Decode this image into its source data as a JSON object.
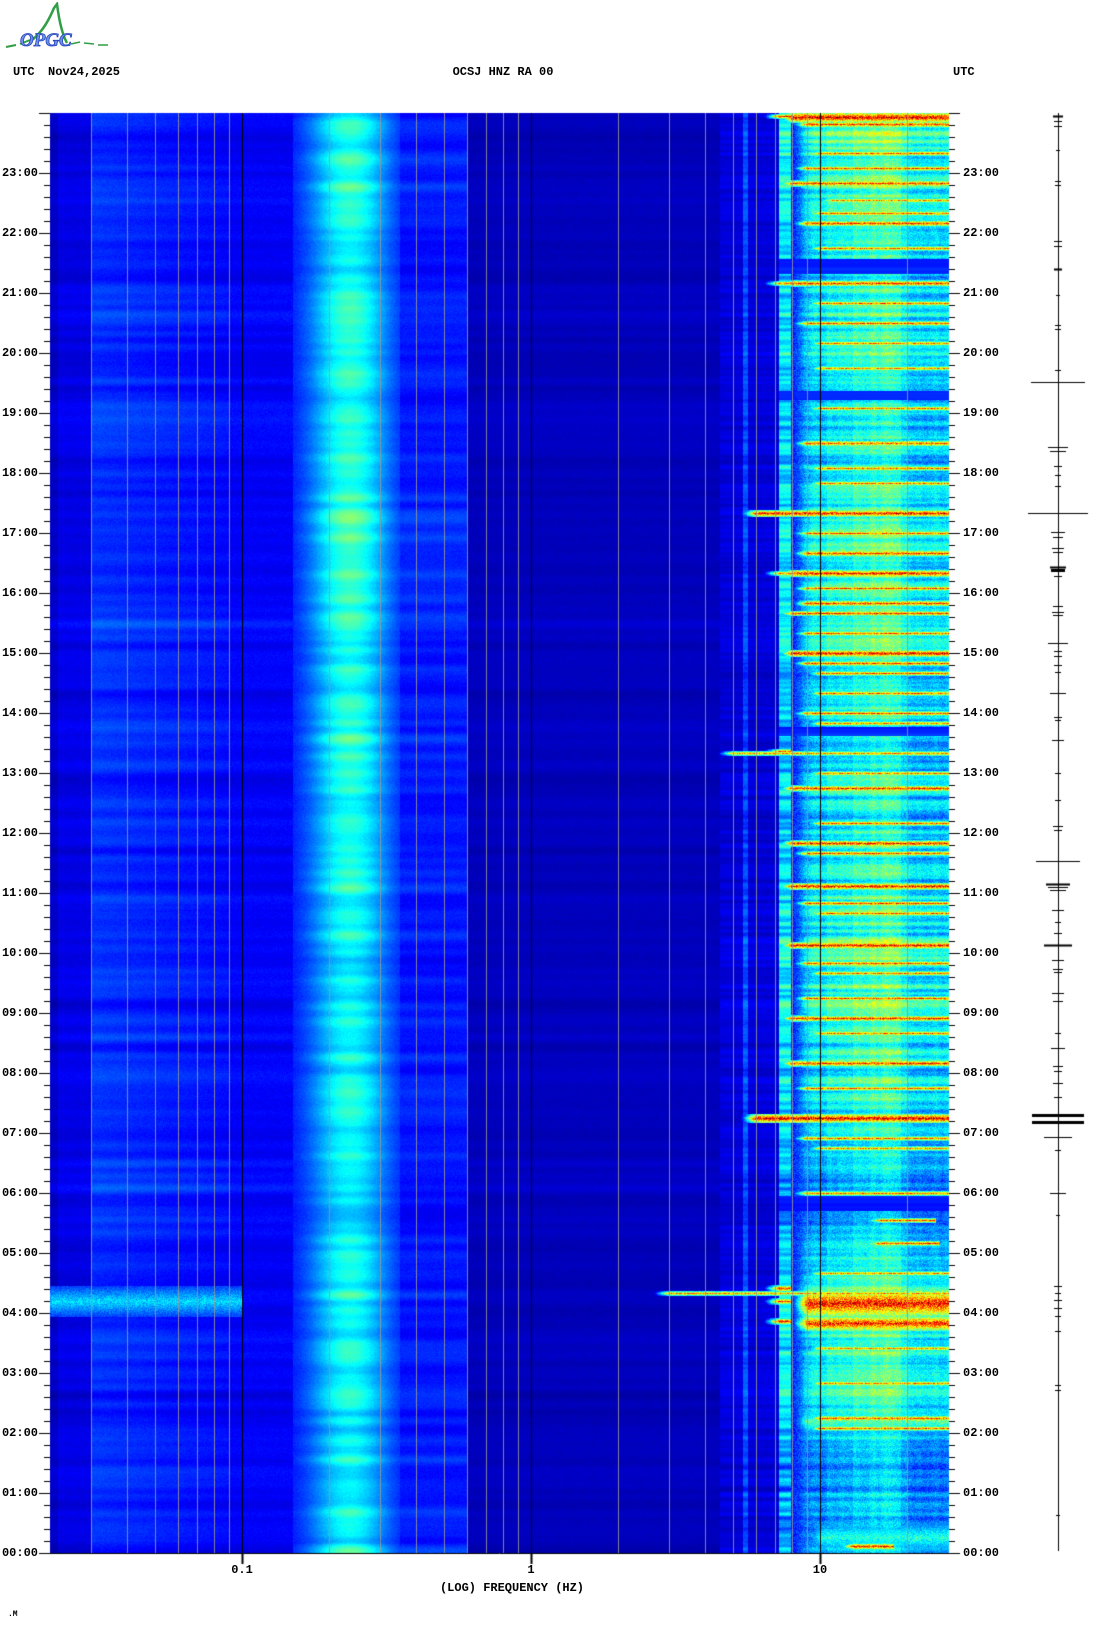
{
  "header": {
    "utc_left": "UTC",
    "date": "Nov24,2025",
    "title": "OCSJ HNZ RA 00",
    "utc_right": "UTC"
  },
  "logo": {
    "text": "OPGC",
    "curve_color": "#2f9e44",
    "text_color": "#6f8fe8"
  },
  "footer_mark": ".M",
  "colors": {
    "background": "#ffffff",
    "text": "#000000",
    "grid_minor": "#969696",
    "grid_major": "#000000",
    "trace": "#000000"
  },
  "chart_data": {
    "type": "heatmap",
    "title": "OCSJ HNZ RA 00",
    "xlabel": "(LOG) FREQUENCY (HZ)",
    "x_scale": "log10",
    "x_range_hz": [
      0.0217,
      28
    ],
    "x_tick_labels": [
      "0.1",
      "1",
      "10"
    ],
    "x_tick_hz": [
      0.1,
      1,
      10
    ],
    "x_grid_minor_hz": [
      0.03,
      0.04,
      0.05,
      0.06,
      0.07,
      0.08,
      0.09,
      0.2,
      0.3,
      0.4,
      0.5,
      0.6,
      0.7,
      0.8,
      0.9,
      2,
      3,
      4,
      5,
      6,
      7,
      8,
      9,
      20
    ],
    "y_axis_unit": "UTC time of day",
    "y_range": [
      "00:00",
      "24:00"
    ],
    "y_minor_tick_minutes": 12,
    "y_hour_labels_top_to_bottom": [
      "23:00",
      "22:00",
      "21:00",
      "20:00",
      "19:00",
      "18:00",
      "17:00",
      "16:00",
      "15:00",
      "14:00",
      "13:00",
      "12:00",
      "11:00",
      "10:00",
      "09:00",
      "08:00",
      "07:00",
      "06:00",
      "05:00",
      "04:00",
      "03:00",
      "02:00",
      "01:00",
      "00:00"
    ],
    "colormap": "jet",
    "bands": [
      {
        "name": "very-low",
        "f": [
          0.0217,
          0.03
        ],
        "level": 0.1
      },
      {
        "name": "low",
        "f": [
          0.03,
          0.09
        ],
        "level": 0.17
      },
      {
        "name": "gap",
        "f": [
          0.09,
          0.15
        ],
        "level": 0.12
      },
      {
        "name": "microseism",
        "f": [
          0.15,
          0.35
        ],
        "level": 0.42
      },
      {
        "name": "mid",
        "f": [
          0.35,
          0.6
        ],
        "level": 0.15
      },
      {
        "name": "quiet",
        "f": [
          0.6,
          4.5
        ],
        "level": 0.06
      },
      {
        "name": "mid-high",
        "f": [
          4.5,
          7.2
        ],
        "level": 0.09
      },
      {
        "name": "line-5.5Hz",
        "f": [
          5.4,
          5.6
        ],
        "level": 0.2
      },
      {
        "name": "line-7.5Hz",
        "f": [
          7.2,
          7.9
        ],
        "level": 0.45
      },
      {
        "name": "high",
        "f": [
          7.9,
          28
        ],
        "level": 0.5
      }
    ],
    "microseism_env_by_hour": [
      0.45,
      0.42,
      0.5,
      0.55,
      0.6,
      0.5,
      0.48,
      0.52,
      0.48,
      0.5,
      0.55,
      0.58,
      0.6,
      0.62,
      0.6,
      0.55,
      0.58,
      0.62,
      0.66,
      0.62,
      0.66,
      0.58,
      0.62,
      0.58
    ],
    "high_band_env_by_hour": [
      0.34,
      0.28,
      0.52,
      0.58,
      0.6,
      0.3,
      0.36,
      0.52,
      0.58,
      0.58,
      0.58,
      0.58,
      0.54,
      0.5,
      0.58,
      0.62,
      0.63,
      0.58,
      0.5,
      0.46,
      0.58,
      0.5,
      0.58,
      0.68
    ],
    "events": [
      [
        "23:56",
        9,
        8,
        28,
        1.0
      ],
      [
        "23:49",
        5,
        9,
        28,
        0.9
      ],
      [
        "23:20",
        4,
        10,
        28,
        0.85
      ],
      [
        "23:05",
        4,
        9,
        28,
        0.88
      ],
      [
        "22:50",
        5,
        8,
        28,
        0.9
      ],
      [
        "22:33",
        3,
        11,
        28,
        0.8
      ],
      [
        "22:20",
        4,
        10,
        28,
        0.85
      ],
      [
        "22:10",
        5,
        9,
        28,
        0.9
      ],
      [
        "21:45",
        4,
        10,
        28,
        0.84
      ],
      [
        "21:10",
        5,
        8,
        28,
        0.9
      ],
      [
        "20:50",
        4,
        10,
        28,
        0.86
      ],
      [
        "20:30",
        4,
        9,
        28,
        0.88
      ],
      [
        "20:10",
        4,
        10,
        28,
        0.82
      ],
      [
        "19:45",
        4,
        10,
        28,
        0.8
      ],
      [
        "19:05",
        4,
        10,
        28,
        0.83
      ],
      [
        "18:30",
        5,
        9,
        28,
        0.86
      ],
      [
        "18:05",
        4,
        10,
        28,
        0.85
      ],
      [
        "17:50",
        4,
        10,
        28,
        0.83
      ],
      [
        "17:20",
        6,
        6,
        28,
        0.95
      ],
      [
        "17:00",
        4,
        9,
        28,
        0.86
      ],
      [
        "16:40",
        5,
        9,
        28,
        0.9
      ],
      [
        "16:20",
        6,
        8,
        28,
        0.95
      ],
      [
        "16:05",
        4,
        9,
        28,
        0.88
      ],
      [
        "15:50",
        5,
        9,
        28,
        0.9
      ],
      [
        "15:40",
        4,
        8,
        28,
        0.92
      ],
      [
        "15:20",
        4,
        9,
        28,
        0.86
      ],
      [
        "15:00",
        6,
        8,
        28,
        0.97
      ],
      [
        "14:50",
        4,
        9,
        28,
        0.9
      ],
      [
        "14:40",
        4,
        10,
        28,
        0.85
      ],
      [
        "14:20",
        4,
        10,
        28,
        0.85
      ],
      [
        "14:00",
        4,
        9,
        28,
        0.88
      ],
      [
        "13:50",
        4,
        10,
        28,
        0.82
      ],
      [
        "13:20",
        4,
        5,
        28,
        0.8
      ],
      [
        "13:00",
        4,
        10,
        28,
        0.82
      ],
      [
        "12:45",
        5,
        8,
        28,
        0.92
      ],
      [
        "12:10",
        4,
        10,
        28,
        0.85
      ],
      [
        "11:50",
        5,
        8,
        28,
        0.94
      ],
      [
        "11:40",
        4,
        9,
        28,
        0.88
      ],
      [
        "11:07",
        6,
        8,
        28,
        0.95
      ],
      [
        "10:50",
        4,
        9,
        28,
        0.88
      ],
      [
        "10:40",
        4,
        10,
        28,
        0.85
      ],
      [
        "10:08",
        6,
        8,
        28,
        0.95
      ],
      [
        "09:50",
        4,
        9,
        28,
        0.88
      ],
      [
        "09:40",
        4,
        10,
        28,
        0.84
      ],
      [
        "09:15",
        4,
        9,
        28,
        0.88
      ],
      [
        "08:55",
        5,
        8,
        28,
        0.92
      ],
      [
        "08:40",
        4,
        10,
        28,
        0.84
      ],
      [
        "08:10",
        5,
        8,
        28,
        0.92
      ],
      [
        "07:45",
        4,
        9,
        28,
        0.85
      ],
      [
        "07:15",
        8,
        6,
        28,
        1.0
      ],
      [
        "06:55",
        4,
        9,
        28,
        0.84
      ],
      [
        "06:45",
        4,
        10,
        28,
        0.8
      ],
      [
        "06:00",
        4,
        9,
        28,
        0.84
      ],
      [
        "05:33",
        3,
        16,
        25,
        0.86
      ],
      [
        "05:10",
        4,
        16,
        26,
        0.9
      ],
      [
        "04:40",
        4,
        10,
        28,
        0.8
      ],
      [
        "04:20",
        4,
        3,
        28,
        0.8
      ],
      [
        "04:10",
        26,
        9,
        28,
        0.96
      ],
      [
        "03:50",
        14,
        9,
        28,
        0.94
      ],
      [
        "03:25",
        4,
        10,
        28,
        0.8
      ],
      [
        "02:50",
        4,
        10,
        28,
        0.82
      ],
      [
        "02:15",
        5,
        10,
        28,
        0.85
      ],
      [
        "02:05",
        4,
        10,
        28,
        0.85
      ],
      [
        "00:07",
        5,
        13,
        18,
        0.95
      ],
      [
        "23:57",
        4,
        7.2,
        7.9,
        0.92
      ],
      [
        "21:10",
        4,
        7.2,
        7.9,
        0.85
      ],
      [
        "16:20",
        4,
        7.2,
        7.9,
        0.85
      ],
      [
        "13:22",
        4,
        7.2,
        7.9,
        0.85
      ],
      [
        "07:15",
        5,
        7.2,
        7.9,
        0.9
      ],
      [
        "04:25",
        5,
        7.2,
        7.9,
        0.95
      ],
      [
        "04:12",
        5,
        7.2,
        7.9,
        0.9
      ],
      [
        "03:52",
        5,
        7.2,
        7.9,
        0.95
      ],
      [
        "04:08",
        48,
        9,
        28,
        0.6
      ],
      [
        "02:12",
        24,
        9,
        28,
        0.52
      ],
      [
        "00:16",
        30,
        10,
        28,
        0.46
      ],
      [
        "04:12",
        30,
        0.022,
        0.1,
        0.38
      ]
    ],
    "quiet_dips": [
      [
        "21:27",
        14
      ],
      [
        "19:18",
        8
      ],
      [
        "13:42",
        8
      ],
      [
        "05:50",
        14
      ]
    ],
    "side_trace_spikes": [
      [
        "23:57",
        5,
        2
      ],
      [
        "23:52",
        4,
        1
      ],
      [
        "23:47",
        4,
        1
      ],
      [
        "23:23",
        2,
        1
      ],
      [
        "22:52",
        3,
        1
      ],
      [
        "22:48",
        3,
        1
      ],
      [
        "21:52",
        4,
        1
      ],
      [
        "21:47",
        4,
        1
      ],
      [
        "21:24",
        4,
        2
      ],
      [
        "20:58",
        2,
        1
      ],
      [
        "20:28",
        3,
        1
      ],
      [
        "20:24",
        3,
        1
      ],
      [
        "19:43",
        3,
        1
      ],
      [
        "19:31",
        27,
        1
      ],
      [
        "18:26",
        10,
        1
      ],
      [
        "18:22",
        8,
        1
      ],
      [
        "18:07",
        4,
        1
      ],
      [
        "17:58",
        3,
        1
      ],
      [
        "17:47",
        3,
        1
      ],
      [
        "17:20",
        30,
        1
      ],
      [
        "17:01",
        7,
        1
      ],
      [
        "16:56",
        5,
        1
      ],
      [
        "16:45",
        6,
        1
      ],
      [
        "16:41",
        5,
        1
      ],
      [
        "16:26",
        8,
        2
      ],
      [
        "16:23",
        7,
        3
      ],
      [
        "16:17",
        4,
        1
      ],
      [
        "15:47",
        5,
        1
      ],
      [
        "15:41",
        6,
        1
      ],
      [
        "15:38",
        5,
        1
      ],
      [
        "15:10",
        10,
        1
      ],
      [
        "15:02",
        4,
        1
      ],
      [
        "14:57",
        4,
        1
      ],
      [
        "14:48",
        4,
        1
      ],
      [
        "14:41",
        3,
        1
      ],
      [
        "14:20",
        8,
        1
      ],
      [
        "13:56",
        4,
        1
      ],
      [
        "13:53",
        3,
        1
      ],
      [
        "13:33",
        6,
        1
      ],
      [
        "13:00",
        3,
        1
      ],
      [
        "12:33",
        3,
        1
      ],
      [
        "12:07",
        5,
        1
      ],
      [
        "12:03",
        4,
        1
      ],
      [
        "11:32",
        22,
        1
      ],
      [
        "11:09",
        12,
        2
      ],
      [
        "11:06",
        10,
        1
      ],
      [
        "11:03",
        8,
        1
      ],
      [
        "10:43",
        6,
        1
      ],
      [
        "10:31",
        3,
        1
      ],
      [
        "10:20",
        4,
        1
      ],
      [
        "10:08",
        14,
        2
      ],
      [
        "09:53",
        6,
        1
      ],
      [
        "09:44",
        5,
        1
      ],
      [
        "09:41",
        4,
        1
      ],
      [
        "09:20",
        6,
        1
      ],
      [
        "09:12",
        5,
        1
      ],
      [
        "08:40",
        3,
        1
      ],
      [
        "08:25",
        7,
        1
      ],
      [
        "08:07",
        5,
        1
      ],
      [
        "08:02",
        4,
        1
      ],
      [
        "07:50",
        5,
        1
      ],
      [
        "07:36",
        4,
        1
      ],
      [
        "07:18",
        26,
        3
      ],
      [
        "07:11",
        26,
        3
      ],
      [
        "06:56",
        14,
        1
      ],
      [
        "06:43",
        3,
        1
      ],
      [
        "06:00",
        8,
        1
      ],
      [
        "05:38",
        2,
        1
      ],
      [
        "04:27",
        4,
        1
      ],
      [
        "04:20",
        3,
        1
      ],
      [
        "04:13",
        4,
        1
      ],
      [
        "04:05",
        4,
        1
      ],
      [
        "03:57",
        3,
        1
      ],
      [
        "03:42",
        3,
        1
      ],
      [
        "02:48",
        3,
        1
      ],
      [
        "02:43",
        3,
        1
      ],
      [
        "00:38",
        2,
        1
      ]
    ]
  }
}
